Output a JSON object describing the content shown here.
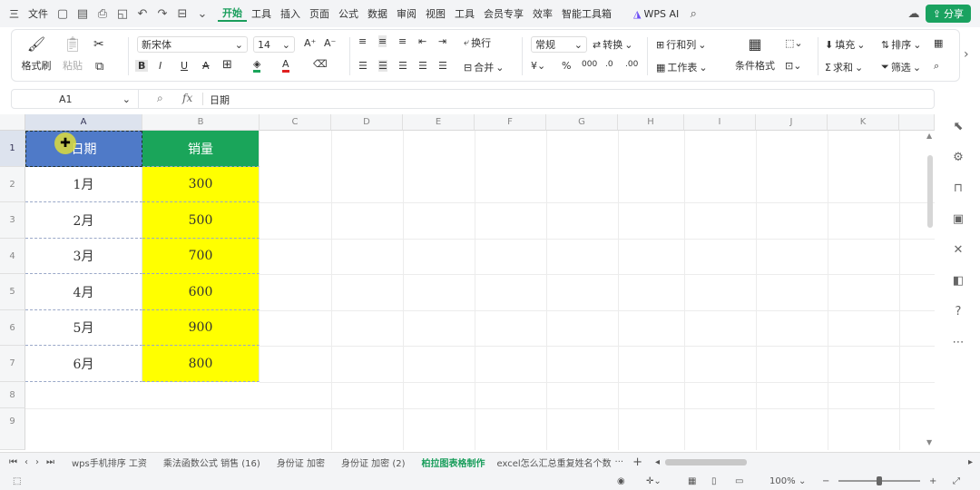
{
  "menu": {
    "hamburger": "三",
    "file": "文件",
    "items": [
      "开始",
      "工具",
      "插入",
      "页面",
      "公式",
      "数据",
      "审阅",
      "视图",
      "工具",
      "会员专享",
      "效率",
      "智能工具箱"
    ],
    "active_index": 0,
    "wps_ai": "WPS AI",
    "share": "分享"
  },
  "ribbon": {
    "format_painter": "格式刷",
    "paste": "粘贴",
    "font_name": "新宋体",
    "font_size": "14",
    "wrap": "换行",
    "merge": "合并",
    "number_format": "常规",
    "convert": "转换",
    "row_col": "行和列",
    "worksheet": "工作表",
    "conditional_format": "条件格式",
    "fill": "填充",
    "sort": "排序",
    "sum": "求和",
    "filter": "筛选"
  },
  "formula_bar": {
    "cell_ref": "A1",
    "fx": "fx",
    "value": "日期"
  },
  "grid": {
    "columns": [
      "A",
      "B",
      "C",
      "D",
      "E",
      "F",
      "G",
      "H",
      "I",
      "J",
      "K"
    ],
    "rows": [
      "1",
      "2",
      "3",
      "4",
      "5",
      "6",
      "7",
      "8",
      "9"
    ],
    "table": {
      "headers": [
        "日期",
        "销量"
      ],
      "rows": [
        [
          "1月",
          "300"
        ],
        [
          "2月",
          "500"
        ],
        [
          "3月",
          "700"
        ],
        [
          "4月",
          "600"
        ],
        [
          "5月",
          "900"
        ],
        [
          "6月",
          "800"
        ]
      ]
    }
  },
  "sheet_tabs": {
    "tabs": [
      "wps手机排序 工资",
      "乘法函数公式 销售 (16)",
      "身份证 加密",
      "身份证 加密 (2)",
      "柏拉图表格制作",
      "excel怎么汇总重复姓名个数"
    ],
    "active_index": 4,
    "more": "···",
    "add": "+"
  },
  "status": {
    "zoom": "100%"
  },
  "colors": {
    "accent": "#1a9e5c",
    "header_green": "#1aa55a",
    "selected_blue": "#4f7ac8",
    "value_yellow": "#ffff00"
  }
}
